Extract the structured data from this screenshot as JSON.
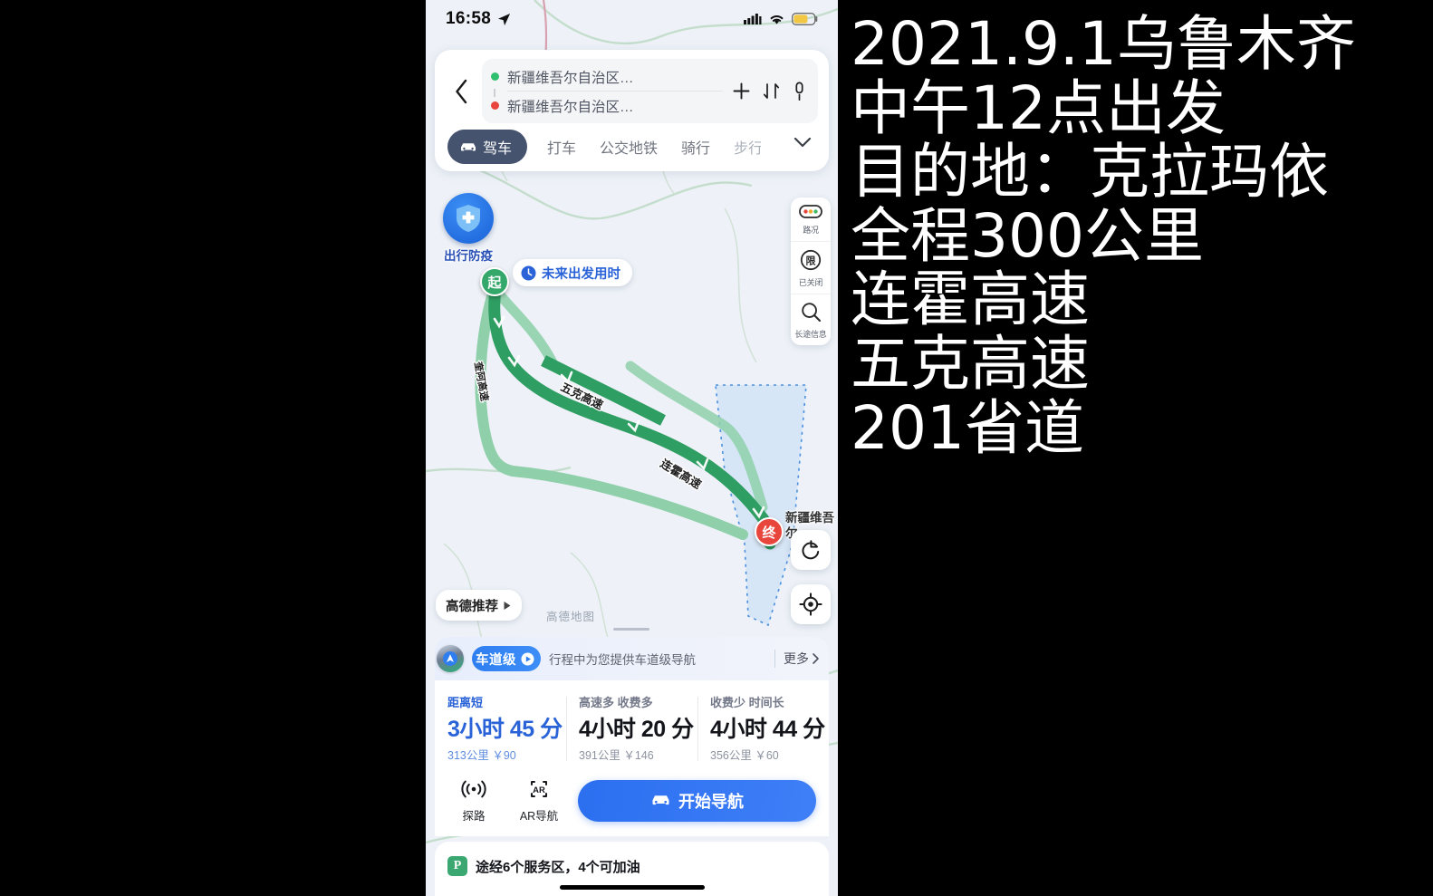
{
  "status_bar": {
    "time": "16:58",
    "location_icon": "location-arrow-icon",
    "signal_icon": "cellular-signal-icon",
    "wifi_icon": "wifi-icon",
    "battery_icon": "battery-low-power-icon"
  },
  "top_card": {
    "back_icon": "back-chevron-icon",
    "start_field": {
      "value": "新疆维吾尔自治区…",
      "dot": "start-dot"
    },
    "end_field": {
      "value": "新疆维吾尔自治区…",
      "dot": "end-dot"
    },
    "actions": {
      "add": "plus-icon",
      "swap": "swap-arrows-icon",
      "voice": "microphone-icon"
    },
    "tabs": [
      {
        "label": "驾车",
        "selected": true,
        "icon": "car-icon"
      },
      {
        "label": "打车",
        "selected": false
      },
      {
        "label": "公交地铁",
        "selected": false
      },
      {
        "label": "骑行",
        "selected": false
      },
      {
        "label": "步行",
        "selected": false
      }
    ],
    "expand_icon": "chevron-down-icon"
  },
  "map": {
    "epidemic_badge": {
      "label": "出行防疫",
      "icon": "shield-cross-icon"
    },
    "future_departure": {
      "label": "未来出发用时",
      "icon": "clock-icon"
    },
    "start_marker": "起",
    "end_marker": "终",
    "end_label": "新疆维吾尔…",
    "road_labels": [
      "五克高速",
      "奎阿高速",
      "连霍高速"
    ],
    "tools": [
      {
        "label": "路况",
        "icon": "traffic-light-icon"
      },
      {
        "label": "已关闭",
        "icon": "restriction-icon"
      },
      {
        "label": "长途信息",
        "icon": "search-icon"
      }
    ],
    "refresh_icon": "refresh-icon",
    "locate_icon": "locate-target-icon",
    "recommend_button": {
      "label": "高德推荐",
      "icon": "play-triangle-icon"
    },
    "watermark": "高德地图"
  },
  "lane_banner": {
    "chip_label": "车道级",
    "chip_icon": "lane-nav-icon",
    "play_icon": "play-circle-icon",
    "description": "行程中为您提供车道级导航",
    "more_label": "更多",
    "more_icon": "chevron-right-icon"
  },
  "routes": [
    {
      "tag": "距离短",
      "time": "3小时 45 分",
      "detail": "313公里 ￥90",
      "selected": true
    },
    {
      "tag": "高速多 收费多",
      "time": "4小时 20 分",
      "detail": "391公里 ￥146",
      "selected": false
    },
    {
      "tag": "收费少 时间长",
      "time": "4小时 44 分",
      "detail": "356公里 ￥60",
      "selected": false
    }
  ],
  "bottom_actions": {
    "explore": {
      "label": "探路",
      "icon": "broadcast-icon"
    },
    "ar": {
      "label": "AR导航",
      "icon": "ar-scan-icon"
    },
    "start_nav": {
      "label": "开始导航",
      "icon": "car-icon"
    }
  },
  "service_info": {
    "icon": "parking-p-icon",
    "text": "途经6个服务区，4个可加油"
  },
  "notes": {
    "lines": [
      "2021.9.1乌鲁木齐",
      "中午12点出发",
      "目的地：克拉玛依",
      "全程300公里",
      "连霍高速",
      "五克高速",
      "201省道"
    ]
  },
  "colors": {
    "accent_blue": "#2a63d8",
    "start_green": "#2fbf6e",
    "end_red": "#e8453c",
    "tab_selected_bg": "#46536f",
    "route_green": "#2f9e63",
    "map_bg": "#eef2f8"
  }
}
